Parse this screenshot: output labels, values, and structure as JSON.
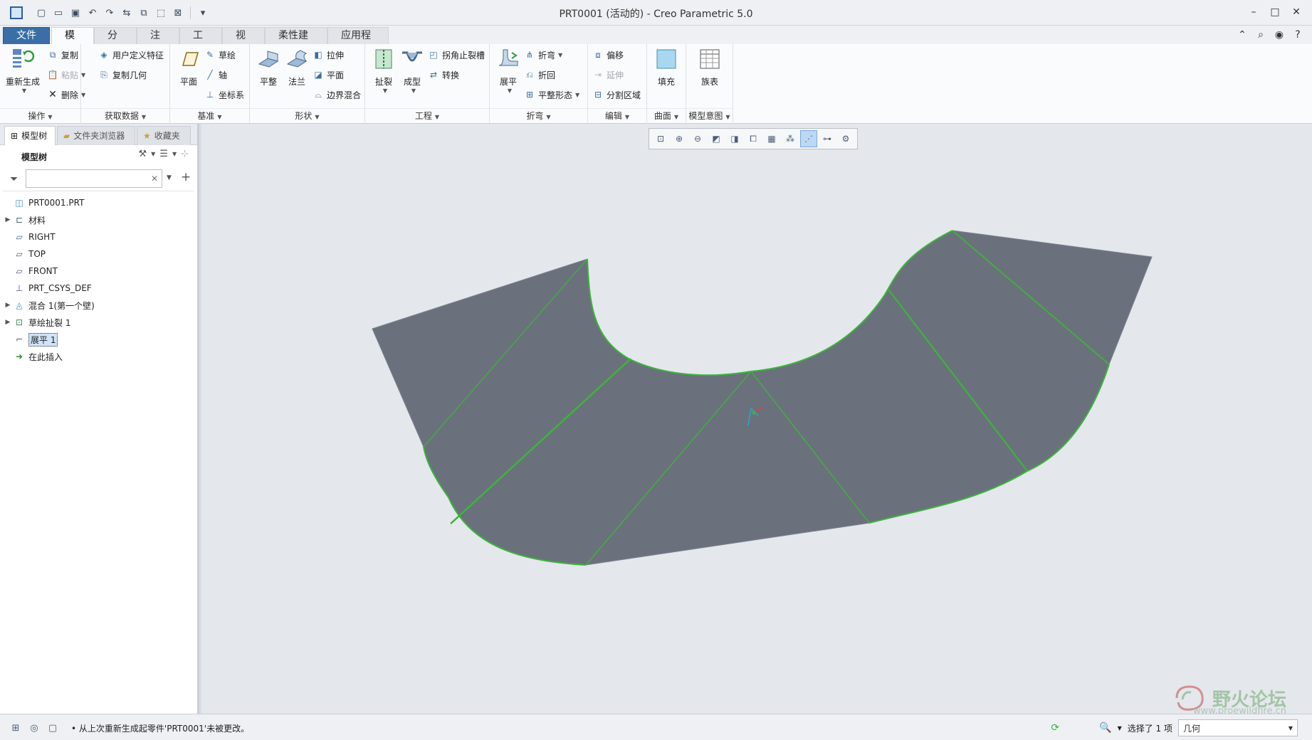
{
  "window": {
    "title": "PRT0001 (活动的) - Creo Parametric 5.0",
    "controls": [
      "minimize-icon",
      "maximize-icon",
      "close-icon"
    ]
  },
  "quick_access": {
    "icons": [
      "new-icon",
      "open-icon",
      "save-icon",
      "undo-icon",
      "redo-icon",
      "regenerate-icon",
      "windows-icon",
      "select-icon",
      "close-window-icon",
      "customize-icon"
    ]
  },
  "tabs": [
    {
      "label": "文件"
    },
    {
      "label": "模型"
    },
    {
      "label": "分析"
    },
    {
      "label": "注释"
    },
    {
      "label": "工具"
    },
    {
      "label": "视图"
    },
    {
      "label": "柔性建模"
    },
    {
      "label": "应用程序"
    }
  ],
  "ribbon": {
    "operations": {
      "label": "操作",
      "regenerate": "重新生成",
      "copy": "复制",
      "paste": "粘贴",
      "delete": "删除"
    },
    "get_data": {
      "label": "获取数据",
      "udf": "用户定义特征",
      "copy_geom": "复制几何"
    },
    "datum": {
      "label": "基准",
      "plane": "平面",
      "sketch": "草绘",
      "axis": "轴",
      "csys": "坐标系"
    },
    "shapes": {
      "label": "形状",
      "flat": "平整",
      "flange": "法兰",
      "extrude": "拉伸",
      "plane": "平面",
      "boundary": "边界混合"
    },
    "engineering": {
      "label": "工程",
      "rip": "扯裂",
      "form": "成型",
      "corner_relief": "拐角止裂槽",
      "convert": "转换"
    },
    "bends": {
      "label": "折弯",
      "unbend": "展平",
      "bend": "折弯",
      "bend_back": "折回",
      "flat_state": "平整形态"
    },
    "editing": {
      "label": "编辑",
      "offset": "偏移",
      "extend": "延伸",
      "split": "分割区域"
    },
    "surfaces": {
      "label": "曲面",
      "fill": "填充"
    },
    "model_intent": {
      "label": "模型意图",
      "family_table": "族表"
    }
  },
  "left_panel": {
    "tabs": [
      "模型树",
      "文件夹浏览器",
      "收藏夹"
    ],
    "tree_title": "模型树",
    "search_value": "",
    "items": [
      {
        "label": "PRT0001.PRT",
        "expandable": false,
        "icon": "part-icon"
      },
      {
        "label": "材料",
        "expandable": true,
        "icon": "material-icon"
      },
      {
        "label": "RIGHT",
        "expandable": false,
        "icon": "datum-plane-icon"
      },
      {
        "label": "TOP",
        "expandable": false,
        "icon": "datum-plane-icon"
      },
      {
        "label": "FRONT",
        "expandable": false,
        "icon": "datum-plane-icon"
      },
      {
        "label": "PRT_CSYS_DEF",
        "expandable": false,
        "icon": "csys-icon"
      },
      {
        "label": "混合 1(第一个壁)",
        "expandable": true,
        "icon": "blend-icon"
      },
      {
        "label": "草绘扯裂 1",
        "expandable": true,
        "icon": "sketch-rip-icon"
      },
      {
        "label": "展平 1",
        "expandable": false,
        "icon": "unbend-icon",
        "selected": true
      },
      {
        "label": "在此插入",
        "expandable": false,
        "icon": "insert-here-icon"
      }
    ]
  },
  "graphics_toolbar": {
    "icons": [
      "refit-icon",
      "zoom-in-icon",
      "zoom-out-icon",
      "repaint-icon",
      "display-style-icon",
      "saved-orientations-icon",
      "view-manager-icon",
      "datum-display-icon",
      "annotation-display-icon",
      "spin-center-icon",
      "appearance-icon"
    ],
    "active": "datum-display-icon"
  },
  "status_bar": {
    "message": "从上次重新生成起零件'PRT0001'未被更改。",
    "selection": "选择了 1 项",
    "filter": "几何"
  },
  "watermark": {
    "text": "野火论坛",
    "url": "www.proewildfire.cn"
  },
  "colors": {
    "surface": "#6b717c",
    "edge": "#3cb43c",
    "file_tab": "#3a6ea5",
    "background": "#e4e7ec"
  }
}
